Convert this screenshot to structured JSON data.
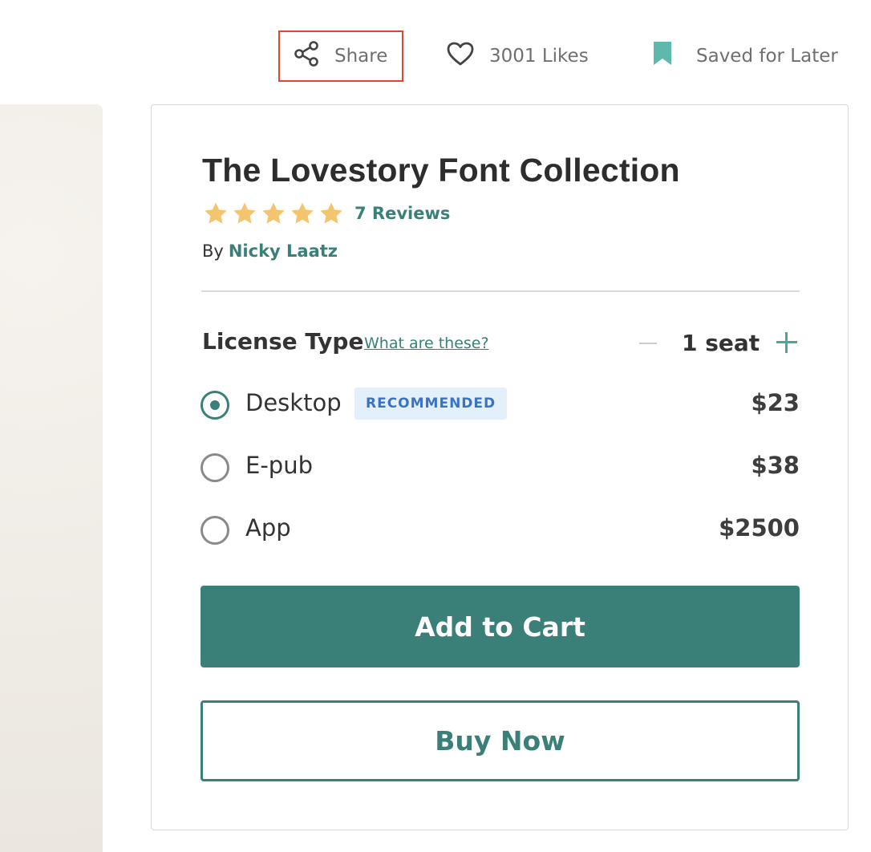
{
  "actions": {
    "share_label": "Share",
    "likes_label": "3001 Likes",
    "saved_label": "Saved for Later"
  },
  "product": {
    "title": "The Lovestory Font Collection",
    "rating_stars": 5,
    "reviews_label": "7 Reviews",
    "by_label": "By",
    "author": "Nicky Laatz"
  },
  "license": {
    "label": "License Type",
    "help_link": "What are these?",
    "seat_count": "1 seat",
    "options": [
      {
        "label": "Desktop",
        "badge": "RECOMMENDED",
        "price": "$23",
        "selected": true
      },
      {
        "label": "E-pub",
        "price": "$38",
        "selected": false
      },
      {
        "label": "App",
        "price": "$2500",
        "selected": false
      }
    ]
  },
  "buttons": {
    "add_to_cart": "Add to Cart",
    "buy_now": "Buy Now"
  },
  "colors": {
    "accent": "#3a7f78",
    "link": "#3a8079",
    "star": "#f5c46f",
    "badge_bg": "#e3f0fb",
    "badge_text": "#3b73c4",
    "highlight_border": "#e2452f"
  },
  "icons": {
    "share": "share-icon",
    "like": "heart-icon",
    "saved": "bookmark-icon",
    "star": "star-icon"
  }
}
